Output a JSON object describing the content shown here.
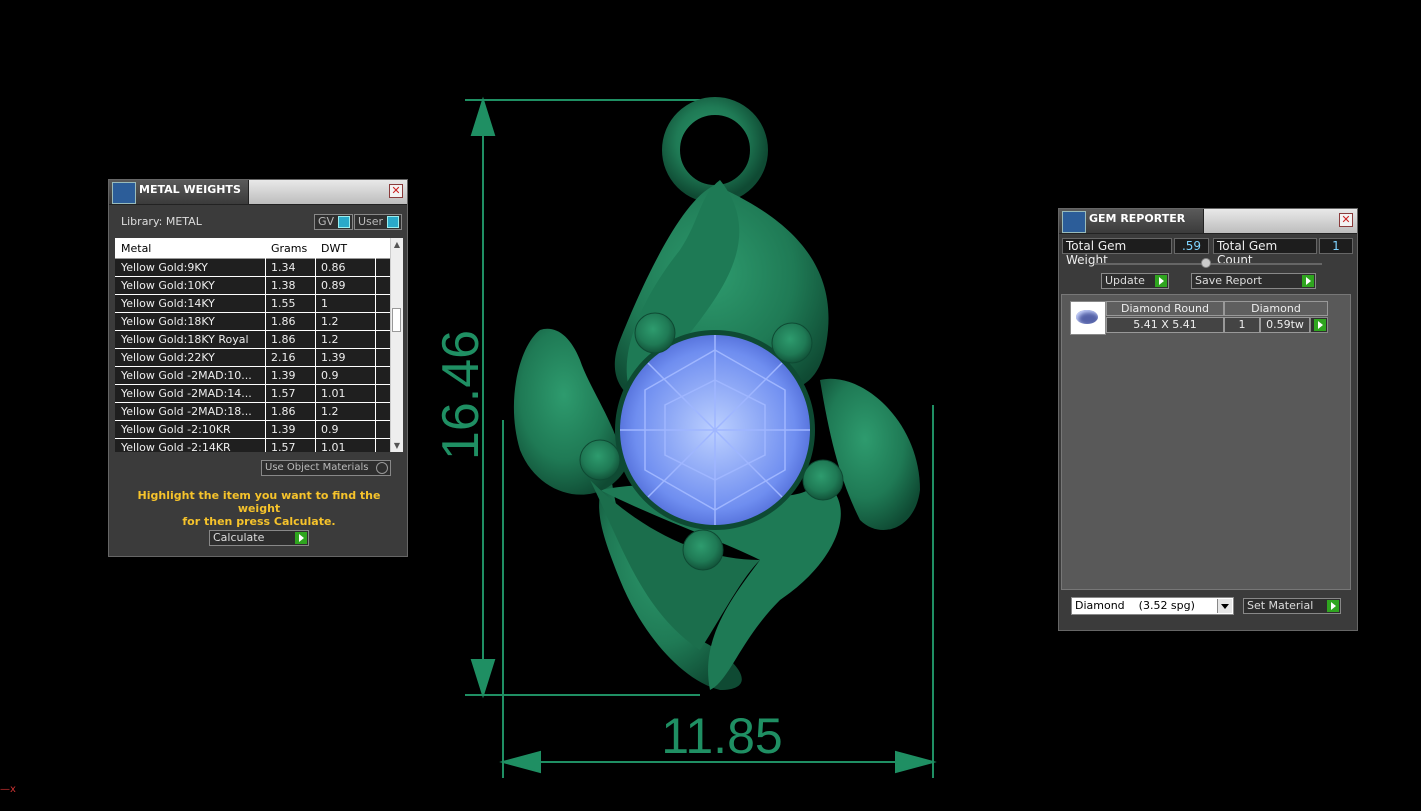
{
  "dimensions": {
    "height": "16.46",
    "width": "11.85"
  },
  "metal_weights": {
    "title": "METAL WEIGHTS",
    "library_label": "Library: METAL",
    "gv_label": "GV",
    "user_label": "User",
    "columns": [
      "Metal",
      "Grams",
      "DWT"
    ],
    "rows": [
      [
        "Yellow Gold:9KY",
        "1.34",
        "0.86"
      ],
      [
        "Yellow Gold:10KY",
        "1.38",
        "0.89"
      ],
      [
        "Yellow Gold:14KY",
        "1.55",
        "1"
      ],
      [
        "Yellow Gold:18KY",
        "1.86",
        "1.2"
      ],
      [
        "Yellow Gold:18KY Royal",
        "1.86",
        "1.2"
      ],
      [
        "Yellow Gold:22KY",
        "2.16",
        "1.39"
      ],
      [
        "Yellow Gold -2MAD:10...",
        "1.39",
        "0.9"
      ],
      [
        "Yellow Gold -2MAD:14...",
        "1.57",
        "1.01"
      ],
      [
        "Yellow Gold -2MAD:18...",
        "1.86",
        "1.2"
      ],
      [
        "Yellow Gold -2:10KR",
        "1.39",
        "0.9"
      ],
      [
        "Yellow Gold -2:14KR",
        "1.57",
        "1.01"
      ]
    ],
    "use_object_materials": "Use Object Materials",
    "hint_line1": "Highlight the item you want to find the weight",
    "hint_line2": "for then press Calculate.",
    "calculate_label": "Calculate"
  },
  "gem_reporter": {
    "title": "GEM REPORTER",
    "total_weight_label": "Total Gem Weight",
    "total_weight_value": ".59",
    "total_count_label": "Total Gem Count",
    "total_count_value": "1",
    "update_label": "Update",
    "save_report_label": "Save Report",
    "gem_headers": [
      "Diamond Round",
      "Diamond"
    ],
    "gem_size": "5.41 X 5.41",
    "gem_count": "1",
    "gem_weight": "0.59tw",
    "material_select": "Diamond    (3.52 spg)",
    "set_material_label": "Set Material"
  },
  "corner_marker": "x"
}
